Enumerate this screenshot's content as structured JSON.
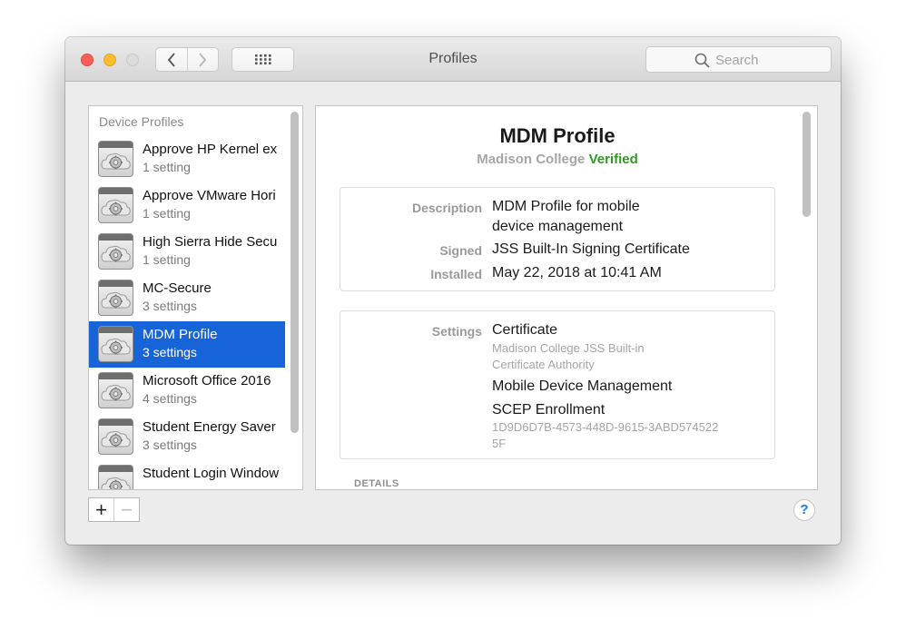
{
  "window": {
    "title": "Profiles"
  },
  "search": {
    "placeholder": "Search"
  },
  "sidebar": {
    "header": "Device Profiles",
    "items": [
      {
        "name": "Approve HP Kernel ex",
        "sub": "1 setting"
      },
      {
        "name": "Approve VMware Hori",
        "sub": "1 setting"
      },
      {
        "name": "High Sierra Hide Secu",
        "sub": "1 setting"
      },
      {
        "name": "MC-Secure",
        "sub": "3 settings"
      },
      {
        "name": "MDM Profile",
        "sub": "3 settings",
        "selected": true
      },
      {
        "name": "Microsoft Office 2016",
        "sub": "4 settings"
      },
      {
        "name": "Student Energy Saver",
        "sub": "3 settings"
      },
      {
        "name": "Student Login Window",
        "sub": ""
      }
    ]
  },
  "footer": {
    "add_label": "+",
    "remove_label": "−",
    "help_label": "?"
  },
  "detail": {
    "title": "MDM Profile",
    "organization": "Madison College",
    "verified": "Verified",
    "info": {
      "description_label": "Description",
      "description_line1": "MDM Profile for mobile",
      "description_line2": "device management",
      "signed_label": "Signed",
      "signed_value": "JSS Built-In Signing Certificate",
      "installed_label": "Installed",
      "installed_value": "May 22, 2018 at 10:41 AM"
    },
    "settings": {
      "label": "Settings",
      "items": [
        {
          "title": "Certificate",
          "sub1": "Madison College JSS Built-in",
          "sub2": "Certificate Authority"
        },
        {
          "title": "Mobile Device Management"
        },
        {
          "title": "SCEP Enrollment",
          "sub1": "1D9D6D7B-4573-448D-9615-3ABD574522",
          "sub2": "5F"
        }
      ]
    },
    "details_heading": "DETAILS"
  },
  "colors": {
    "selection": "#1764d8",
    "verified": "#2f9a22",
    "close": "#fc5f57",
    "minimize": "#fdbc2e"
  },
  "icons": [
    "chevron-left-icon",
    "chevron-right-icon",
    "grid-icon",
    "search-icon",
    "profile-gear-icon",
    "help-icon"
  ]
}
